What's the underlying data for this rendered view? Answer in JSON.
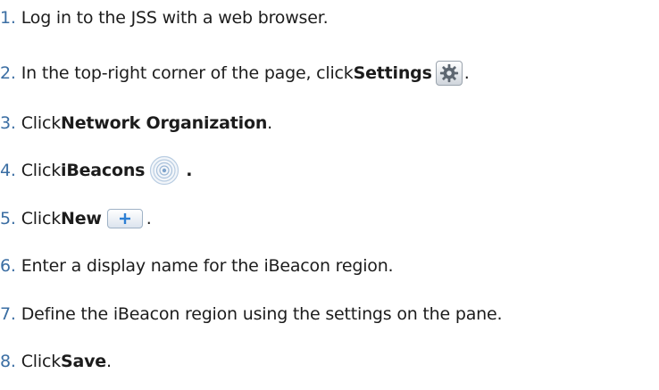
{
  "steps": [
    {
      "num": "1.",
      "text": "Log in to the JSS with a web browser."
    },
    {
      "num": "2.",
      "pre": "In the top-right corner of the page, click ",
      "bold": "Settings",
      "icon": "gear-icon",
      "post": "."
    },
    {
      "num": "3.",
      "pre": "Click ",
      "bold": "Network Organization",
      "post": "."
    },
    {
      "num": "4.",
      "pre": "Click ",
      "bold": "iBeacons",
      "icon": "ibeacon-icon",
      "post": "."
    },
    {
      "num": "5.",
      "pre": "Click ",
      "bold": "New",
      "icon": "plus-icon",
      "post": "."
    },
    {
      "num": "6.",
      "text": "Enter a display name for the iBeacon region."
    },
    {
      "num": "7.",
      "text": "Define the iBeacon region using the settings on the pane."
    },
    {
      "num": "8.",
      "pre": "Click ",
      "bold": "Save",
      "post": "."
    }
  ],
  "colors": {
    "number": "#3b6ea3",
    "text": "#1c1c1c"
  }
}
